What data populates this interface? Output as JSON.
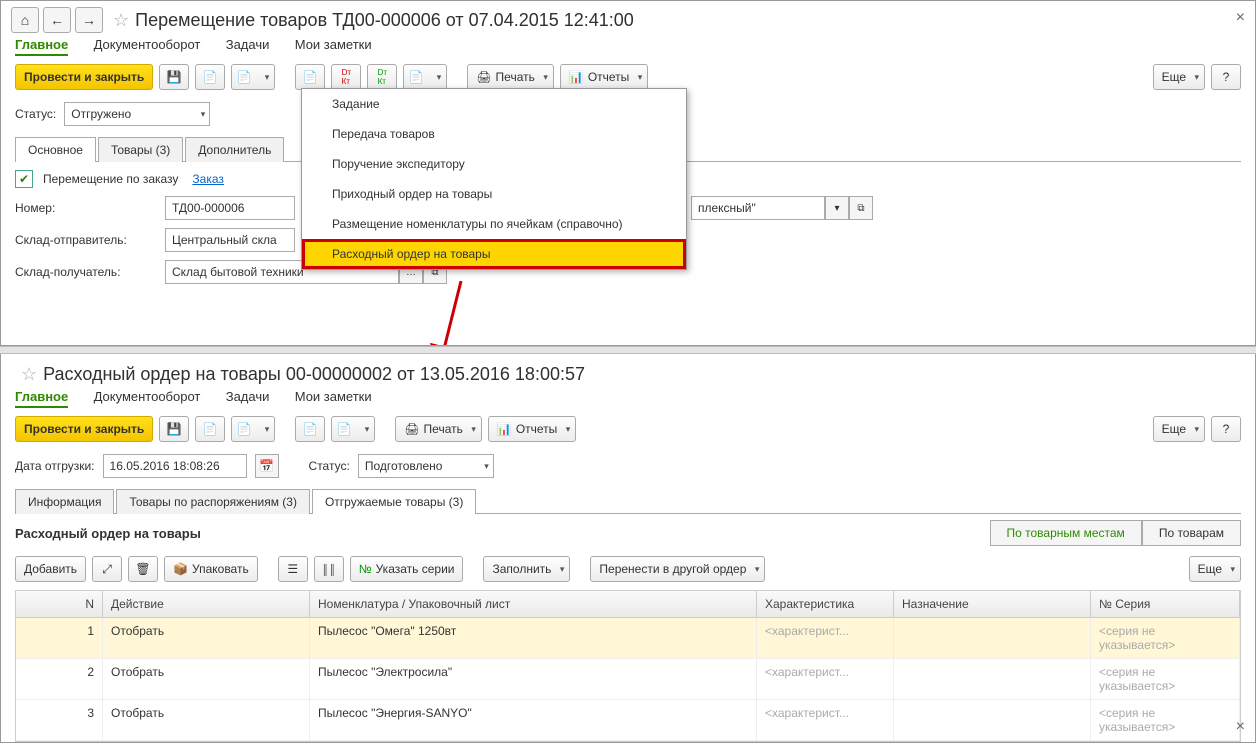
{
  "top": {
    "title": "Перемещение товаров ТД00-000006 от 07.04.2015 12:41:00",
    "navs": {
      "main": "Главное",
      "doc": "Документооборот",
      "tasks": "Задачи",
      "notes": "Мои заметки"
    },
    "toolbar": {
      "post_close": "Провести и закрыть",
      "print": "Печать",
      "reports": "Отчеты",
      "more": "Еще"
    },
    "status_label": "Статус:",
    "status_value": "Отгружено",
    "tabs": {
      "main": "Основное",
      "goods": "Товары (3)",
      "extra": "Дополнитель"
    },
    "by_order_label": "Перемещение по заказу",
    "order_link": "Заказ",
    "rows": {
      "number_label": "Номер:",
      "number_value": "ТД00-000006",
      "sender_label": "Склад-отправитель:",
      "sender_value": "Центральный скла",
      "receiver_label": "Склад-получатель:",
      "receiver_value": "Склад бытовой техники",
      "right_value": "плексный\""
    },
    "menu": {
      "i1": "Задание",
      "i2": "Передача товаров",
      "i3": "Поручение экспедитору",
      "i4": "Приходный ордер на товары",
      "i5": "Размещение номенклатуры по ячейкам (справочно)",
      "i6": "Расходный ордер на товары"
    }
  },
  "bottom": {
    "title": "Расходный ордер на товары 00-00000002 от 13.05.2016 18:00:57",
    "navs": {
      "main": "Главное",
      "doc": "Документооборот",
      "tasks": "Задачи",
      "notes": "Мои заметки"
    },
    "toolbar": {
      "post_close": "Провести и закрыть",
      "print": "Печать",
      "reports": "Отчеты",
      "more": "Еще"
    },
    "ship_date_label": "Дата отгрузки:",
    "ship_date_value": "16.05.2016 18:08:26",
    "status_label": "Статус:",
    "status_value": "Подготовлено",
    "tabs": {
      "info": "Информация",
      "by_ord": "Товары по распоряжениям (3)",
      "ship": "Отгружаемые товары (3)"
    },
    "section_title": "Расходный ордер на товары",
    "toggles": {
      "by_place": "По товарным местам",
      "by_goods": "По товарам"
    },
    "row_toolbar": {
      "add": "Добавить",
      "pack": "Упаковать",
      "series": "Указать серии",
      "fill": "Заполнить",
      "move": "Перенести в другой ордер",
      "more": "Еще"
    },
    "columns": {
      "n": "N",
      "act": "Действие",
      "nom": "Номенклатура / Упаковочный лист",
      "har": "Характеристика",
      "naz": "Назначение",
      "ser": "Серия",
      "ser_icon": "№"
    },
    "rows": [
      {
        "n": "1",
        "act": "Отобрать",
        "nom": "Пылесос \"Омега\" 1250вт",
        "har": "<характерист...",
        "ser": "<серия не указывается>"
      },
      {
        "n": "2",
        "act": "Отобрать",
        "nom": "Пылесос \"Электросила\"",
        "har": "<характерист...",
        "ser": "<серия не указывается>"
      },
      {
        "n": "3",
        "act": "Отобрать",
        "nom": "Пылесос \"Энергия-SANYO\"",
        "har": "<характерист...",
        "ser": "<серия не указывается>"
      }
    ]
  }
}
